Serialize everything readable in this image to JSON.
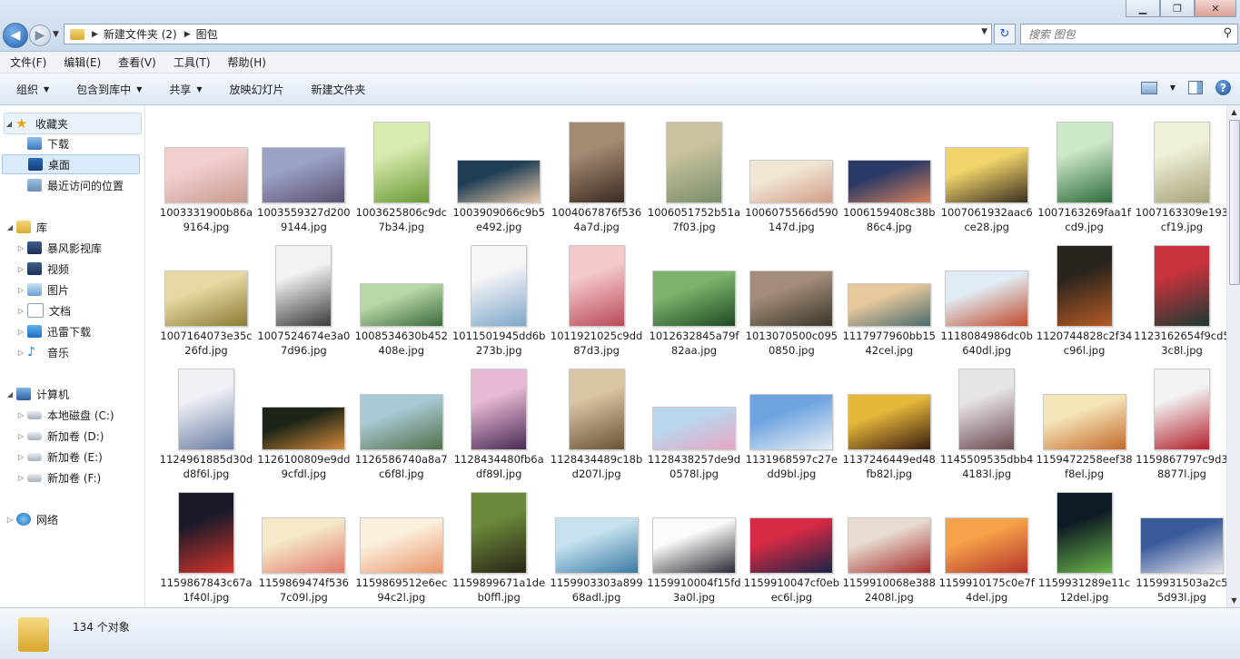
{
  "window": {
    "minimize_glyph": "▁",
    "maximize_glyph": "❐",
    "close_glyph": "✕"
  },
  "address": {
    "crumbs": [
      "新建文件夹 (2)",
      "图包"
    ],
    "search_placeholder": "搜索 图包"
  },
  "menu": [
    "文件(F)",
    "编辑(E)",
    "查看(V)",
    "工具(T)",
    "帮助(H)"
  ],
  "commands": [
    {
      "label": "组织",
      "dropdown": true
    },
    {
      "label": "包含到库中",
      "dropdown": true
    },
    {
      "label": "共享",
      "dropdown": true
    },
    {
      "label": "放映幻灯片",
      "dropdown": false
    },
    {
      "label": "新建文件夹",
      "dropdown": false
    }
  ],
  "nav": {
    "favorites": {
      "label": "收藏夹",
      "items": [
        "下载",
        "桌面",
        "最近访问的位置"
      ]
    },
    "libraries": {
      "label": "库",
      "items": [
        "暴风影视库",
        "视频",
        "图片",
        "文档",
        "迅雷下载",
        "音乐"
      ]
    },
    "computer": {
      "label": "计算机",
      "items": [
        "本地磁盘 (C:)",
        "新加卷 (D:)",
        "新加卷 (E:)",
        "新加卷 (F:)"
      ]
    },
    "network": {
      "label": "网络"
    }
  },
  "files": [
    {
      "name": "1003331900b86a9164.jpg",
      "aspect": "wide",
      "colors": [
        "#f1cfcf",
        "#c99a8e"
      ]
    },
    {
      "name": "1003559327d2009144.jpg",
      "aspect": "wide",
      "colors": [
        "#9aa3c6",
        "#5b4f6f"
      ]
    },
    {
      "name": "1003625806c9dc7b34.jpg",
      "aspect": "tall",
      "colors": [
        "#d9ecb0",
        "#6c9a37"
      ]
    },
    {
      "name": "1003909066c9b5e492.jpg",
      "aspect": "wider",
      "colors": [
        "#1f3e55",
        "#e8c8a8"
      ]
    },
    {
      "name": "1004067876f5364a7d.jpg",
      "aspect": "tall",
      "colors": [
        "#a58a72",
        "#3b2a22"
      ]
    },
    {
      "name": "1006051752b51a7f03.jpg",
      "aspect": "tall",
      "colors": [
        "#c9c2a0",
        "#7a8f6a"
      ]
    },
    {
      "name": "1006075566d590147d.jpg",
      "aspect": "wider",
      "colors": [
        "#f1e6d4",
        "#d19d87"
      ]
    },
    {
      "name": "1006159408c38b86c4.jpg",
      "aspect": "wider",
      "colors": [
        "#2b3a66",
        "#d8805b"
      ]
    },
    {
      "name": "1007061932aac6ce28.jpg",
      "aspect": "wide",
      "colors": [
        "#f0d36a",
        "#3a2f20"
      ]
    },
    {
      "name": "1007163269faa1fcd9.jpg",
      "aspect": "tall",
      "colors": [
        "#cde7c9",
        "#2e6c3c"
      ]
    },
    {
      "name": "1007163309e193cf19.jpg",
      "aspect": "tall",
      "colors": [
        "#f1f0d8",
        "#a6a27a"
      ]
    },
    {
      "name": "1007164073e35c26fd.jpg",
      "aspect": "wide",
      "colors": [
        "#e8d9a4",
        "#8b7a32"
      ]
    },
    {
      "name": "1007524674e3a07d96.jpg",
      "aspect": "tall",
      "colors": [
        "#f2f2f2",
        "#3a3a3a"
      ]
    },
    {
      "name": "1008534630b452408e.jpg",
      "aspect": "wider",
      "colors": [
        "#b8d7a6",
        "#3b6a3e"
      ]
    },
    {
      "name": "1011501945dd6b273b.jpg",
      "aspect": "tall",
      "colors": [
        "#f6f6f8",
        "#7ea6c9"
      ]
    },
    {
      "name": "1011921025c9dd87d3.jpg",
      "aspect": "tall",
      "colors": [
        "#f5c9c9",
        "#b94a5a"
      ]
    },
    {
      "name": "1012632845a79f82aa.jpg",
      "aspect": "wide",
      "colors": [
        "#7cb36b",
        "#1f4a24"
      ]
    },
    {
      "name": "1013070500c0950850.jpg",
      "aspect": "wide",
      "colors": [
        "#a48b7a",
        "#3a3628"
      ]
    },
    {
      "name": "1117977960bb1542cel.jpg",
      "aspect": "wider",
      "colors": [
        "#e7c89b",
        "#4a6a6e"
      ]
    },
    {
      "name": "1118084986dc0b640dl.jpg",
      "aspect": "wide",
      "colors": [
        "#e0ecf3",
        "#c24a2c"
      ]
    },
    {
      "name": "1120744828c2f34c96l.jpg",
      "aspect": "tall",
      "colors": [
        "#2a241e",
        "#b55a24"
      ]
    },
    {
      "name": "1123162654f9cd53c8l.jpg",
      "aspect": "tall",
      "colors": [
        "#c8323c",
        "#1b3a34"
      ]
    },
    {
      "name": "1124961885d30dd8f6l.jpg",
      "aspect": "tall",
      "colors": [
        "#eef0f5",
        "#6a7da4"
      ]
    },
    {
      "name": "1126100809e9dd9cfdl.jpg",
      "aspect": "wider",
      "colors": [
        "#1b2416",
        "#d48a3a"
      ]
    },
    {
      "name": "1126586740a8a7c6f8l.jpg",
      "aspect": "wide",
      "colors": [
        "#a9c9d4",
        "#51704a"
      ]
    },
    {
      "name": "1128434480fb6adf89l.jpg",
      "aspect": "tall",
      "colors": [
        "#e7b9d5",
        "#4a2a54"
      ]
    },
    {
      "name": "1128434489c18bd207l.jpg",
      "aspect": "tall",
      "colors": [
        "#d9c4a3",
        "#6a5236"
      ]
    },
    {
      "name": "1128438257de9d0578l.jpg",
      "aspect": "wider",
      "colors": [
        "#b8d7ef",
        "#e8a6c2"
      ]
    },
    {
      "name": "1131968597c27edd9bl.jpg",
      "aspect": "wide",
      "colors": [
        "#6fa4e0",
        "#e8eef6"
      ]
    },
    {
      "name": "1137246449ed48fb82l.jpg",
      "aspect": "wide",
      "colors": [
        "#e6b83a",
        "#3a1c10"
      ]
    },
    {
      "name": "1145509535dbb44183l.jpg",
      "aspect": "tall",
      "colors": [
        "#e8e4e6",
        "#6a4a4e"
      ]
    },
    {
      "name": "1159472258eef38f8el.jpg",
      "aspect": "wide",
      "colors": [
        "#f5e4b8",
        "#c46a2a"
      ]
    },
    {
      "name": "1159867797c9d38877l.jpg",
      "aspect": "tall",
      "colors": [
        "#f2f2f2",
        "#b21e2a"
      ]
    },
    {
      "name": "1159867843c67a1f40l.jpg",
      "aspect": "tall",
      "colors": [
        "#1a1a2a",
        "#d4342c"
      ]
    },
    {
      "name": "1159869474f5367c09l.jpg",
      "aspect": "wide",
      "colors": [
        "#f6e9c9",
        "#e0786a"
      ]
    },
    {
      "name": "1159869512e6ec94c2l.jpg",
      "aspect": "wide",
      "colors": [
        "#fbf0dc",
        "#e8946a"
      ]
    },
    {
      "name": "1159899671a1deb0ffl.jpg",
      "aspect": "tall",
      "colors": [
        "#6a8a3a",
        "#2a2416"
      ]
    },
    {
      "name": "1159903303a89968adl.jpg",
      "aspect": "wide",
      "colors": [
        "#c6e2ef",
        "#3a7aa4"
      ]
    },
    {
      "name": "1159910004f15fd3a0l.jpg",
      "aspect": "wide",
      "colors": [
        "#fbfbfb",
        "#2a2a34"
      ]
    },
    {
      "name": "1159910047cf0ebec6l.jpg",
      "aspect": "wide",
      "colors": [
        "#d62a44",
        "#1a2446"
      ]
    },
    {
      "name": "1159910068e3882408l.jpg",
      "aspect": "wide",
      "colors": [
        "#e8dcd0",
        "#a42a2a"
      ]
    },
    {
      "name": "1159910175c0e7f4del.jpg",
      "aspect": "wide",
      "colors": [
        "#f6a24a",
        "#b4342a"
      ]
    },
    {
      "name": "1159931289e11c12del.jpg",
      "aspect": "tall",
      "colors": [
        "#0e1a24",
        "#6ab44a"
      ]
    },
    {
      "name": "1159931503a2c55d93l.jpg",
      "aspect": "wide",
      "colors": [
        "#3a5a9a",
        "#e6e6ee"
      ]
    }
  ],
  "status": {
    "count_text": "134 个对象"
  }
}
